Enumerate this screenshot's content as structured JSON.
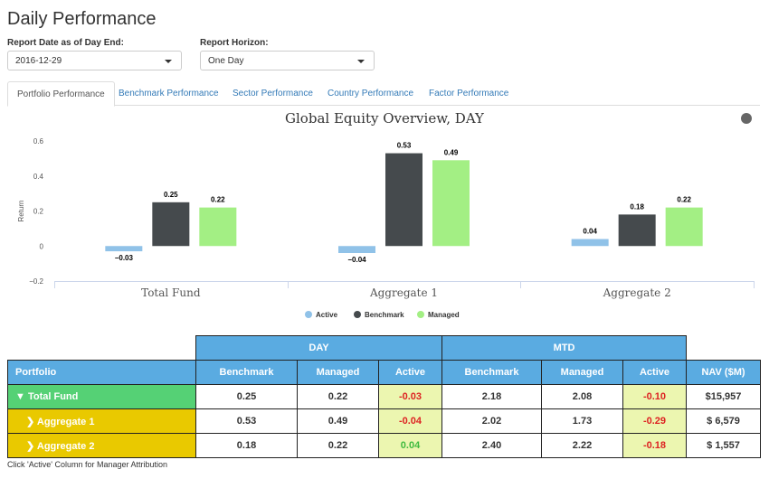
{
  "page": {
    "title": "Daily Performance"
  },
  "controls": {
    "report_date": {
      "label": "Report Date as of Day End:",
      "value": "2016-12-29"
    },
    "report_horizon": {
      "label": "Report Horizon:",
      "value": "One Day"
    }
  },
  "tabs": [
    {
      "label": "Portfolio Performance",
      "active": true
    },
    {
      "label": "Benchmark Performance",
      "active": false
    },
    {
      "label": "Sector Performance",
      "active": false
    },
    {
      "label": "Country Performance",
      "active": false
    },
    {
      "label": "Factor Performance",
      "active": false
    }
  ],
  "chart_data": {
    "type": "bar",
    "title": "Global Equity Overview, DAY",
    "ylabel": "Return",
    "xlabel": "",
    "ylim": [
      -0.2,
      0.6
    ],
    "yticks": [
      0.6,
      0.4,
      0.2,
      0,
      -0.2
    ],
    "ytick_labels": [
      "0.6",
      "0.4",
      "0.2",
      "0",
      "−0.2"
    ],
    "grid": false,
    "legend": "bottom-center",
    "categories": [
      "Total Fund",
      "Aggregate 1",
      "Aggregate 2"
    ],
    "series": [
      {
        "name": "Active",
        "color": "#90c2e8",
        "values": [
          -0.03,
          -0.04,
          0.04
        ],
        "labels": [
          "−0.03",
          "−0.04",
          "0.04"
        ]
      },
      {
        "name": "Benchmark",
        "color": "#454a4d",
        "values": [
          0.25,
          0.53,
          0.18
        ],
        "labels": [
          "0.25",
          "0.53",
          "0.18"
        ]
      },
      {
        "name": "Managed",
        "color": "#a3ef84",
        "values": [
          0.22,
          0.49,
          0.22
        ],
        "labels": [
          "0.22",
          "0.49",
          "0.22"
        ]
      }
    ]
  },
  "table": {
    "group_headers": [
      "DAY",
      "MTD"
    ],
    "columns": [
      "Portfolio",
      "Benchmark",
      "Managed",
      "Active",
      "Benchmark",
      "Managed",
      "Active",
      "NAV ($M)"
    ],
    "rows": [
      {
        "name": "Total Fund",
        "expanded": true,
        "level": "total",
        "day_bench": "0.25",
        "day_managed": "0.22",
        "day_active": "-0.03",
        "mtd_bench": "2.18",
        "mtd_managed": "2.08",
        "mtd_active": "-0.10",
        "nav": "$15,957"
      },
      {
        "name": "Aggregate 1",
        "expanded": false,
        "level": "aggregate",
        "day_bench": "0.53",
        "day_managed": "0.49",
        "day_active": "-0.04",
        "mtd_bench": "2.02",
        "mtd_managed": "1.73",
        "mtd_active": "-0.29",
        "nav": "$ 6,579"
      },
      {
        "name": "Aggregate 2",
        "expanded": false,
        "level": "aggregate",
        "day_bench": "0.18",
        "day_managed": "0.22",
        "day_active": "0.04",
        "mtd_bench": "2.40",
        "mtd_managed": "2.22",
        "mtd_active": "-0.18",
        "nav": "$ 1,557"
      }
    ],
    "colors": {
      "header": "#5aabe1",
      "total_row": "#55d175",
      "aggregate_row": "#e9c900",
      "active_cell": "#ecf6b0",
      "negative": "#dd2222",
      "positive": "#3fba3f"
    },
    "footnote": "Click 'Active' Column for Manager Attribution"
  }
}
